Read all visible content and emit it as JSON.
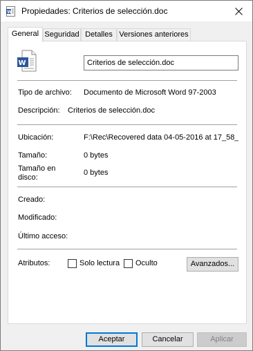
{
  "window": {
    "title": "Propiedades: Criterios de selección.doc"
  },
  "tabs": [
    {
      "label": "General"
    },
    {
      "label": "Seguridad"
    },
    {
      "label": "Detalles"
    },
    {
      "label": "Versiones anteriores"
    }
  ],
  "general": {
    "filename": "Criterios de selección.doc",
    "file_type_label": "Tipo de archivo:",
    "file_type_value": "Documento de Microsoft Word 97-2003",
    "description_label": "Descripción:",
    "description_value": "Criterios de selección.doc",
    "location_label": "Ubicación:",
    "location_value": "F:\\Rec\\Recovered data 04-05-2016 at 17_58_",
    "size_label": "Tamaño:",
    "size_value": "0 bytes",
    "size_on_disk_label_line1": "Tamaño en",
    "size_on_disk_label_line2": "disco:",
    "size_on_disk_value": "0 bytes",
    "created_label": "Creado:",
    "modified_label": "Modificado:",
    "accessed_label": "Último acceso:",
    "attributes_label": "Atributos:",
    "readonly_label": "Solo lectura",
    "hidden_label": "Oculto",
    "advanced_button": "Avanzados..."
  },
  "buttons": {
    "accept": "Aceptar",
    "cancel": "Cancelar",
    "apply": "Aplicar"
  },
  "icons": {
    "title_icon": "word-document-icon",
    "file_icon": "word-document-icon",
    "close": "close-icon"
  },
  "colors": {
    "accent": "#0078d7",
    "word_blue": "#2b579a"
  }
}
